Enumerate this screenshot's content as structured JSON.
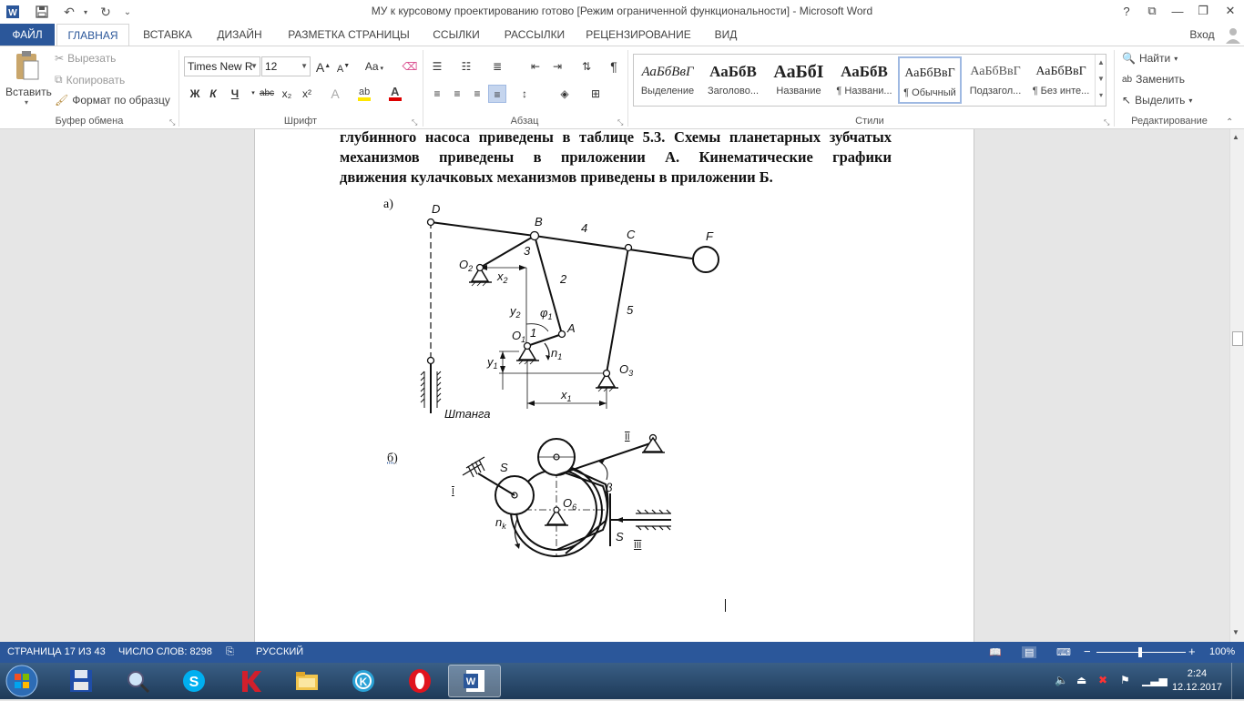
{
  "window": {
    "title": "МУ к курсовому проектированию готово [Режим ограниченной функциональности] - Microsoft Word",
    "help": "?",
    "close": "✕",
    "minimize": "—",
    "restore": "❐",
    "ribbon_display": "⧉"
  },
  "tabs": {
    "file": "ФАЙЛ",
    "home": "ГЛАВНАЯ",
    "insert": "ВСТАВКА",
    "design": "ДИЗАЙН",
    "layout": "РАЗМЕТКА СТРАНИЦЫ",
    "references": "ССЫЛКИ",
    "mailings": "РАССЫЛКИ",
    "review": "РЕЦЕНЗИРОВАНИЕ",
    "view": "ВИД",
    "signin": "Вход"
  },
  "clipboard": {
    "paste": "Вставить",
    "cut": "Вырезать",
    "copy": "Копировать",
    "format_painter": "Формат по образцу",
    "label": "Буфер обмена"
  },
  "font": {
    "family": "Times New R",
    "size": "12",
    "label": "Шрифт",
    "bold": "Ж",
    "italic": "К",
    "underline": "Ч",
    "strike": "abc",
    "subscript": "x₂",
    "superscript": "x²",
    "grow": "A",
    "shrink": "A",
    "case": "Aa"
  },
  "paragraph": {
    "label": "Абзац"
  },
  "styles": {
    "label": "Стили",
    "items": [
      {
        "sample": "АаБбВвГ",
        "name": "Выделение"
      },
      {
        "sample": "АаБбВ",
        "name": "Заголово..."
      },
      {
        "sample": "АаБбІ",
        "name": "Название"
      },
      {
        "sample": "АаБбВ",
        "name": "¶ Названи..."
      },
      {
        "sample": "АаБбВвГ",
        "name": "¶ Обычный"
      },
      {
        "sample": "АаБбВвГ",
        "name": "Подзагол..."
      },
      {
        "sample": "АаБбВвГ",
        "name": "¶ Без инте..."
      }
    ]
  },
  "editing": {
    "find": "Найти",
    "replace": "Заменить",
    "select": "Выделить",
    "label": "Редактирование"
  },
  "document": {
    "lines": [
      "глубинного насоса приведены в таблице 5.3. Схемы планетарных зубчатых",
      "механизмов приведены в приложении А. Кинематические графики",
      "движения кулачковых механизмов приведены в приложении Б."
    ],
    "caption_a": "а)",
    "caption_b": "б)",
    "fig_a": {
      "D": "D",
      "B": "B",
      "C": "C",
      "F": "F",
      "A": "A",
      "O2": "O",
      "O2_sub": "2",
      "O1": "O",
      "O1_sub": "1",
      "O3": "O",
      "O3_sub": "3",
      "n1": "n",
      "n1_sub": "1",
      "phi1": "φ",
      "phi1_sub": "1",
      "x2": "x",
      "x2_sub": "2",
      "y2": "y",
      "y2_sub": "2",
      "y1": "y",
      "y1_sub": "1",
      "x1": "x",
      "x1_sub": "1",
      "l1": "1",
      "l2": "2",
      "l3": "3",
      "l4": "4",
      "l5": "5",
      "rod": "Штанга"
    },
    "fig_b": {
      "S_top": "S",
      "S_right": "S",
      "beta": "β",
      "nk": "n",
      "nk_sub": "k",
      "O6": "O",
      "O6_sub": "6",
      "I": "I",
      "II": "II",
      "III": "III"
    }
  },
  "statusbar": {
    "page": "СТРАНИЦА 17 ИЗ 43",
    "words": "ЧИСЛО СЛОВ: 8298",
    "lang": "РУССКИЙ",
    "zoom": "100%",
    "zoom_minus": "−",
    "zoom_plus": "+"
  },
  "taskbar": {
    "time": "2:24",
    "date": "12.12.2017"
  },
  "colors": {
    "accent": "#2b579a",
    "ribbon_bg": "#ffffff",
    "doc_bg": "#e6e6e6"
  }
}
